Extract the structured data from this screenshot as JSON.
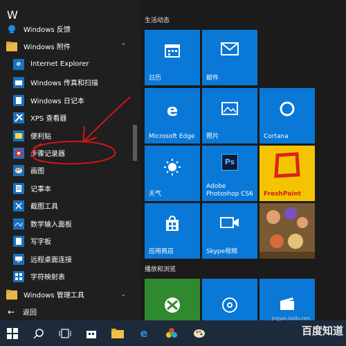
{
  "left_panel": {
    "letter": "W",
    "items": [
      {
        "label": "Windows 反馈",
        "icon": "feedback-icon",
        "type": "app"
      },
      {
        "label": "Windows 附件",
        "icon": "folder-icon",
        "type": "folder",
        "expanded": true
      },
      {
        "label": "Internet Explorer",
        "icon": "ie-icon",
        "type": "app"
      },
      {
        "label": "Windows 传真和扫描",
        "icon": "fax-icon",
        "type": "app"
      },
      {
        "label": "Windows 日记本",
        "icon": "journal-icon",
        "type": "app"
      },
      {
        "label": "XPS 查看器",
        "icon": "xps-icon",
        "type": "app"
      },
      {
        "label": "便利贴",
        "icon": "sticky-notes-icon",
        "type": "app"
      },
      {
        "label": "步骤记录器",
        "icon": "steps-recorder-icon",
        "type": "app"
      },
      {
        "label": "画图",
        "icon": "paint-icon",
        "type": "app"
      },
      {
        "label": "记事本",
        "icon": "notepad-icon",
        "type": "app"
      },
      {
        "label": "截图工具",
        "icon": "snipping-tool-icon",
        "type": "app"
      },
      {
        "label": "数学输入面板",
        "icon": "math-input-icon",
        "type": "app"
      },
      {
        "label": "写字板",
        "icon": "wordpad-icon",
        "type": "app"
      },
      {
        "label": "远程桌面连接",
        "icon": "remote-desktop-icon",
        "type": "app"
      },
      {
        "label": "字符映射表",
        "icon": "charmap-icon",
        "type": "app"
      },
      {
        "label": "Windows 管理工具",
        "icon": "folder-icon",
        "type": "folder",
        "expanded": false
      }
    ],
    "back_label": "返回"
  },
  "tiles": {
    "group1_title": "生活动态",
    "group2_title": "播放和浏览",
    "items": [
      {
        "label": "日历",
        "icon": "calendar-icon"
      },
      {
        "label": "邮件",
        "icon": "mail-icon"
      },
      {
        "label": "Microsoft Edge",
        "icon": "edge-icon"
      },
      {
        "label": "照片",
        "icon": "photos-icon"
      },
      {
        "label": "Cortana",
        "icon": "cortana-icon"
      },
      {
        "label": "天气",
        "icon": "weather-icon"
      },
      {
        "label": "Adobe Photoshop CS6",
        "icon": "photoshop-icon",
        "badge": "Ps"
      },
      {
        "label": "FreshPaint",
        "icon": "freshpaint-icon"
      },
      {
        "label": "应用商店",
        "icon": "store-icon"
      },
      {
        "label": "Skype视频",
        "icon": "skype-video-icon"
      },
      {
        "label": "",
        "icon": "game-icon"
      },
      {
        "label": "",
        "icon": "xbox-icon"
      },
      {
        "label": "",
        "icon": "groove-icon"
      },
      {
        "label": "",
        "icon": "movies-icon"
      }
    ]
  },
  "taskbar": {
    "buttons": [
      "start-icon",
      "search-icon",
      "task-view-icon",
      "store-icon",
      "explorer-icon",
      "edge-icon",
      "color-app-icon",
      "paint-icon"
    ]
  },
  "watermark": {
    "text": "百度知道",
    "sub": "jingyan.baidu.com"
  },
  "colors": {
    "tile_blue": "#0a78d7",
    "freshpaint_yellow": "#f5c400",
    "annotation_red": "#d41414"
  }
}
